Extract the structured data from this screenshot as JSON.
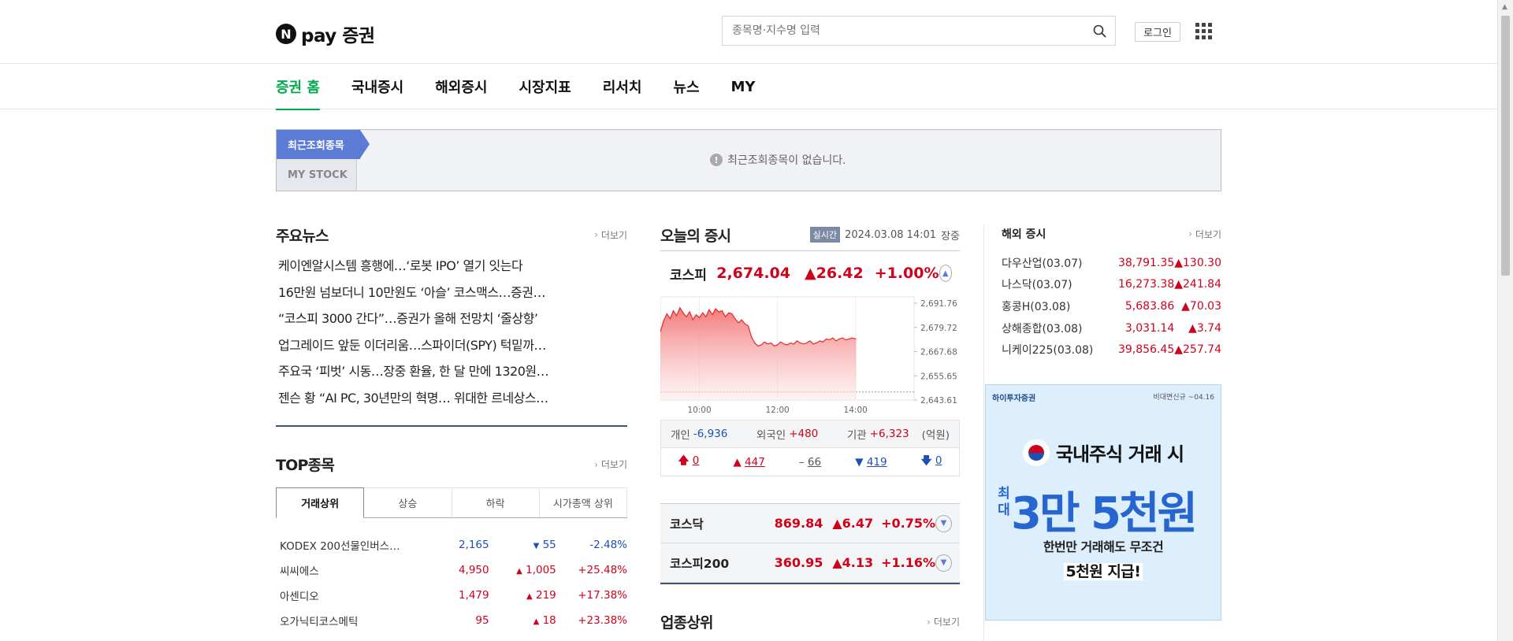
{
  "header": {
    "logo_mark": "N",
    "logo_text": "pay 증권",
    "search_placeholder": "종목명·지수명 입력",
    "login_label": "로그인"
  },
  "nav": {
    "tabs": [
      "증권 홈",
      "국내증시",
      "해외증시",
      "시장지표",
      "리서치",
      "뉴스",
      "MY"
    ]
  },
  "recent": {
    "tab_recent": "최근조회종목",
    "tab_mystock": "MY STOCK",
    "empty_msg": "최근조회종목이 없습니다.",
    "info_glyph": "!"
  },
  "news": {
    "title": "주요뉴스",
    "more": "더보기",
    "items": [
      "케이엔알시스템 흥행에…‘로봇 IPO’ 열기 잇는다",
      "16만원 넘보더니 10만원도 ‘아슬’ 코스맥스…증권…",
      "“코스피 3000 간다”…증권가 올해 전망치 ‘줄상향’",
      "업그레이드 앞둔 이더리움…스파이더(SPY) 턱밑까…",
      "주요국 ‘피벗’ 시동…장중 환율, 한 달 만에 1320원…",
      "젠슨 황 “AI PC, 30년만의 혁명… 위대한 르네상스…"
    ]
  },
  "top": {
    "title": "TOP종목",
    "more": "더보기",
    "tabs": [
      "거래상위",
      "상승",
      "하락",
      "시가총액 상위"
    ],
    "rows": [
      {
        "name": "KODEX 200선물인버스…",
        "price": "2,165",
        "dir": "▼",
        "chg": "55",
        "rate": "-2.48%",
        "cls": "down"
      },
      {
        "name": "씨씨에스",
        "price": "4,950",
        "dir": "▲",
        "chg": "1,005",
        "rate": "+25.48%",
        "cls": "up"
      },
      {
        "name": "아센디오",
        "price": "1,479",
        "dir": "▲",
        "chg": "219",
        "rate": "+17.38%",
        "cls": "up"
      },
      {
        "name": "오가닉티코스메틱",
        "price": "95",
        "dir": "▲",
        "chg": "18",
        "rate": "+23.38%",
        "cls": "up"
      }
    ]
  },
  "market": {
    "title": "오늘의 증시",
    "realtime": "실시간",
    "datetime": "2024.03.08 14:01",
    "status": "장중",
    "kospi": {
      "name": "코스피",
      "value": "2,674.04",
      "chg": "▲26.42",
      "rate": "+1.00%"
    },
    "investor": {
      "label_ind": "개인",
      "ind": "-6,936",
      "label_for": "외국인",
      "for": "+480",
      "label_inst": "기관",
      "inst": "+6,323",
      "unit": "(억원)"
    },
    "breadth": {
      "limit_up": "0",
      "up": "447",
      "flat": "66",
      "down": "419",
      "limit_down": "0"
    },
    "kosdaq": {
      "name": "코스닥",
      "value": "869.84",
      "chg": "▲6.47",
      "rate": "+0.75%"
    },
    "kospi200": {
      "name": "코스피200",
      "value": "360.95",
      "chg": "▲4.13",
      "rate": "+1.16%"
    },
    "sector_title": "업종상위",
    "sector_more": "더보기"
  },
  "chart_data": {
    "type": "area",
    "title": "",
    "x_ticks": [
      "10:00",
      "12:00",
      "14:00"
    ],
    "y_ticks": [
      "2,691.76",
      "2,679.72",
      "2,667.68",
      "2,655.65",
      "2,643.61"
    ],
    "ylim": [
      2643.61,
      2691.76
    ],
    "x_minutes": [
      0,
      5,
      10,
      15,
      20,
      25,
      30,
      35,
      40,
      45,
      50,
      55,
      60,
      65,
      70,
      75,
      80,
      85,
      90,
      95,
      100,
      105,
      110,
      115,
      120,
      125,
      130,
      135,
      140,
      145,
      150,
      155,
      160,
      165,
      170,
      175,
      180,
      185,
      190,
      195,
      200,
      205,
      210,
      215,
      220,
      225,
      230,
      235,
      240,
      245,
      250,
      255,
      260,
      265,
      270,
      275,
      280,
      285,
      290,
      295,
      300,
      301
    ],
    "values": [
      2677.5,
      2683.0,
      2686.5,
      2684.0,
      2688.0,
      2685.5,
      2689.5,
      2687.0,
      2685.0,
      2687.5,
      2683.5,
      2686.0,
      2684.5,
      2687.0,
      2685.0,
      2688.5,
      2686.0,
      2689.0,
      2687.5,
      2688.0,
      2685.0,
      2687.0,
      2686.5,
      2684.0,
      2682.0,
      2683.5,
      2681.5,
      2680.5,
      2675.0,
      2672.0,
      2670.5,
      2671.0,
      2672.5,
      2671.5,
      2672.0,
      2670.5,
      2671.0,
      2672.5,
      2671.5,
      2671.0,
      2672.0,
      2671.5,
      2673.0,
      2672.0,
      2671.5,
      2672.0,
      2673.0,
      2671.5,
      2672.0,
      2673.0,
      2672.5,
      2674.0,
      2673.5,
      2674.5,
      2673.0,
      2674.0,
      2674.5,
      2673.5,
      2674.0,
      2674.5,
      2674.0,
      2674.04
    ],
    "baseline": 2647.62,
    "x_range_minutes": [
      0,
      390
    ],
    "color": "#e8282b"
  },
  "overseas": {
    "title": "해외 증시",
    "more": "더보기",
    "rows": [
      {
        "name": "다우산업(03.07)",
        "value": "38,791.35",
        "chg": "▲130.30"
      },
      {
        "name": "나스닥(03.07)",
        "value": "16,273.38",
        "chg": "▲241.84"
      },
      {
        "name": "홍콩H(03.08)",
        "value": "5,683.86",
        "chg": "▲70.03"
      },
      {
        "name": "상해종합(03.08)",
        "value": "3,031.14",
        "chg": "▲3.74"
      },
      {
        "name": "니케이225(03.08)",
        "value": "39,856.45",
        "chg": "▲257.74"
      }
    ]
  },
  "ad": {
    "brand": "하이투자증권",
    "note": "비대면신규 ~04.16",
    "headline": "국내주식 거래 시",
    "prefix": "최대",
    "big": "3만 5천원",
    "sub": "한번만 거래해도 무조건",
    "sub2": "5천원 지급!"
  },
  "colors": {
    "accent": "#03a94d",
    "up": "#d0021b",
    "down": "#1e50b4",
    "recent_tab": "#5b7bd5"
  }
}
